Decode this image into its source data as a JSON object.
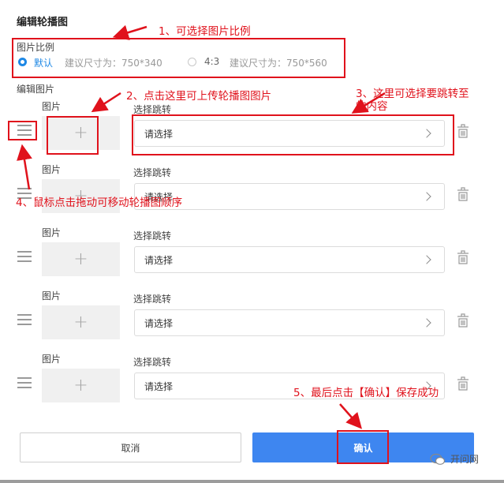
{
  "page": {
    "title": "编辑轮播图"
  },
  "ratio": {
    "label": "图片比例",
    "options": [
      {
        "name": "默认",
        "hint": "建议尺寸为：750*340",
        "selected": true
      },
      {
        "name": "4:3",
        "hint": "建议尺寸为：750*560",
        "selected": false
      }
    ]
  },
  "images": {
    "label": "编辑图片",
    "rows": [
      {
        "image_label": "图片",
        "jump_label": "选择跳转",
        "select_value": "请选择"
      },
      {
        "image_label": "图片",
        "jump_label": "选择跳转",
        "select_value": "请选择"
      },
      {
        "image_label": "图片",
        "jump_label": "选择跳转",
        "select_value": "请选择"
      },
      {
        "image_label": "图片",
        "jump_label": "选择跳转",
        "select_value": "请选择"
      },
      {
        "image_label": "图片",
        "jump_label": "选择跳转",
        "select_value": "请选择"
      }
    ]
  },
  "buttons": {
    "cancel": "取消",
    "confirm": "确认"
  },
  "annotations": {
    "a1": "1、可选择图片比例",
    "a2": "2、点击这里可上传轮播图图片",
    "a3_line1": "3、这里可选择要跳转至",
    "a3_line2": "的内容",
    "a4": "4、鼠标点击拖动可移动轮播图顺序",
    "a5": "5、最后点击【确认】保存成功"
  },
  "watermark": "开问网",
  "colors": {
    "accent": "#1e88e5",
    "confirm": "#3e86f0",
    "annotation": "#e0121c"
  }
}
